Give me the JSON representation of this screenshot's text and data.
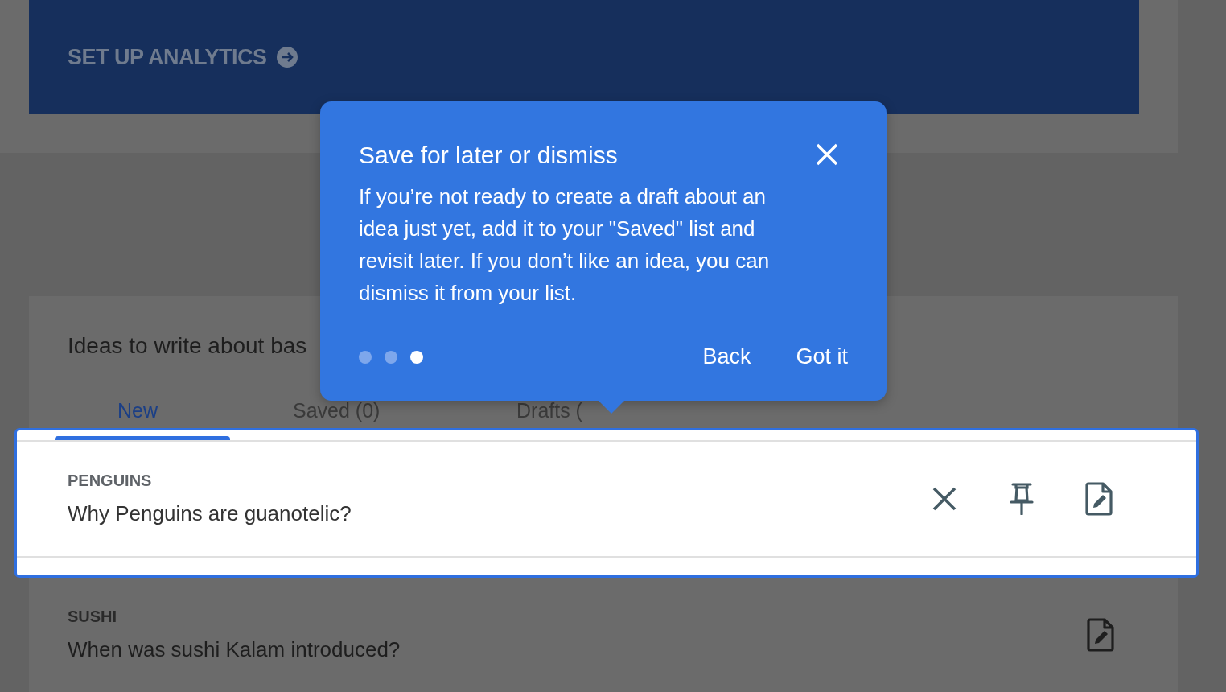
{
  "banner": {
    "link": "SET UP ANALYTICS"
  },
  "ideas_card": {
    "heading": "Ideas to write about bas"
  },
  "tabs": [
    {
      "label": "New",
      "selected": true
    },
    {
      "label": "Saved (0)",
      "selected": false
    },
    {
      "label": "Drafts (",
      "selected": false
    }
  ],
  "ideas": [
    {
      "category": "PENGUINS",
      "question": "Why Penguins are guanotelic?",
      "highlighted": true,
      "actions": [
        {
          "kind": "dismiss"
        },
        {
          "kind": "pin"
        },
        {
          "kind": "draft"
        }
      ]
    },
    {
      "category": "SUSHI",
      "question": "When was sushi Kalam introduced?",
      "highlighted": false,
      "actions": [
        {
          "kind": "draft"
        }
      ]
    }
  ],
  "tooltip": {
    "title": "Save for later or dismiss",
    "body": "If you’re not ready to create a draft about an idea just yet, add it to your \"Saved\" list and revisit later. If you don’t like an idea, you can dismiss it from your list.",
    "steps": [
      {
        "selected": false
      },
      {
        "selected": false
      },
      {
        "selected": true
      }
    ],
    "buttons": [
      "Back",
      "Got it"
    ]
  }
}
